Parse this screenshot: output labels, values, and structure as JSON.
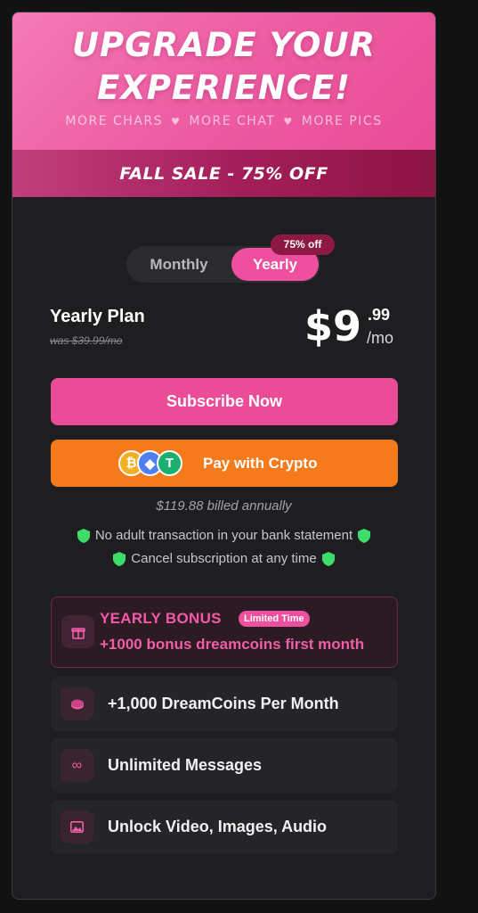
{
  "hero": {
    "title_line1": "UPGRADE YOUR",
    "title_line2": "EXPERIENCE!",
    "perks": [
      "MORE CHARS",
      "MORE CHAT",
      "MORE PICS"
    ]
  },
  "sale_banner": "FALL SALE - 75% OFF",
  "billing_toggle": {
    "monthly_label": "Monthly",
    "yearly_label": "Yearly",
    "selected": "Yearly",
    "discount_badge": "75% off"
  },
  "plan": {
    "name": "Yearly Plan",
    "was_price": "was $39.99/mo",
    "price_main": "$9",
    "price_cents": ".99",
    "price_period": "/mo"
  },
  "actions": {
    "subscribe_label": "Subscribe Now",
    "crypto_label": "Pay with Crypto",
    "coin_icons": [
      "bitcoin-icon",
      "ethereum-icon",
      "tether-icon"
    ]
  },
  "billing_note": "$119.88 billed annually",
  "assurances": [
    "No adult transaction in your bank statement",
    "Cancel subscription at any time"
  ],
  "bonus": {
    "title": "YEARLY BONUS",
    "badge": "Limited Time",
    "description": "+1000 bonus dreamcoins first month"
  },
  "features": [
    {
      "icon": "coins-icon",
      "label": "+1,000 DreamCoins Per Month"
    },
    {
      "icon": "infinity-icon",
      "label": "Unlimited Messages"
    },
    {
      "icon": "image-icon",
      "label": "Unlock Video, Images, Audio"
    }
  ],
  "colors": {
    "accent_pink": "#ee4f9e",
    "crypto_orange": "#f47a1c",
    "sale_banner": "#a31e59",
    "card_bg": "#1e1e20",
    "shield_green": "#3ddc6b"
  }
}
